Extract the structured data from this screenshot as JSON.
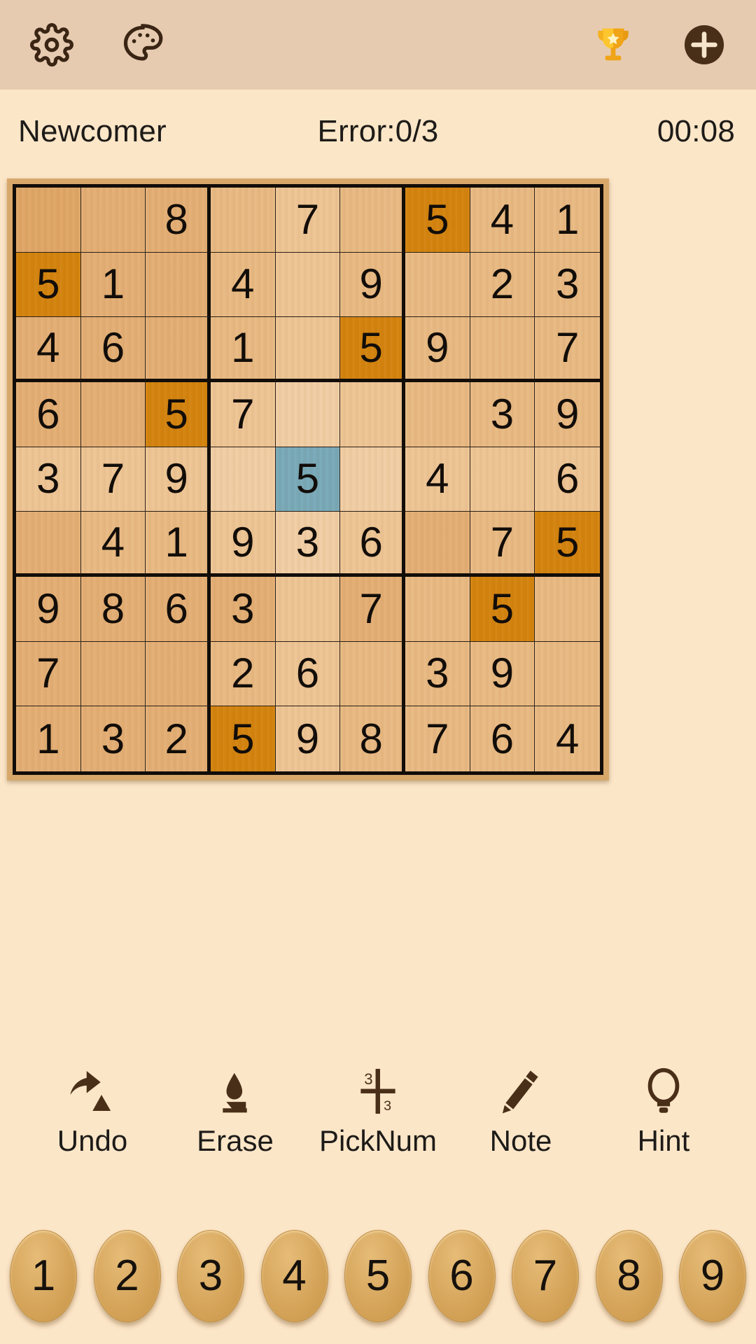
{
  "appbar": {
    "settings_icon": "gear-icon",
    "theme_icon": "palette-icon",
    "trophy_icon": "trophy-icon",
    "add_icon": "plus-circle-icon",
    "background_color": "#e6cbb0"
  },
  "status": {
    "level": "Newcomer",
    "errors": "Error:0/3",
    "timer": "00:08"
  },
  "board": {
    "selected_cell": {
      "row": 5,
      "col": 5,
      "value": "5"
    },
    "highlight_color": "#d3830e",
    "selected_color": "#78a9b8",
    "rows": [
      [
        {
          "v": "",
          "s": "",
          "w": "w0"
        },
        {
          "v": "",
          "s": "",
          "w": "w1"
        },
        {
          "v": "8",
          "s": "",
          "w": "w1"
        },
        {
          "v": "",
          "s": "",
          "w": "w2"
        },
        {
          "v": "7",
          "s": "",
          "w": "w3"
        },
        {
          "v": "",
          "s": "",
          "w": "w2"
        },
        {
          "v": "5",
          "s": "hl",
          "w": "w5"
        },
        {
          "v": "4",
          "s": "",
          "w": "w2"
        },
        {
          "v": "1",
          "s": "",
          "w": "w2"
        }
      ],
      [
        {
          "v": "5",
          "s": "hl",
          "w": "w5"
        },
        {
          "v": "1",
          "s": "",
          "w": "w1"
        },
        {
          "v": "",
          "s": "",
          "w": "w1"
        },
        {
          "v": "4",
          "s": "",
          "w": "w2"
        },
        {
          "v": "",
          "s": "",
          "w": "w3"
        },
        {
          "v": "9",
          "s": "",
          "w": "w2"
        },
        {
          "v": "",
          "s": "",
          "w": "w2"
        },
        {
          "v": "2",
          "s": "",
          "w": "w2"
        },
        {
          "v": "3",
          "s": "",
          "w": "w2"
        }
      ],
      [
        {
          "v": "4",
          "s": "",
          "w": "w1"
        },
        {
          "v": "6",
          "s": "",
          "w": "w1"
        },
        {
          "v": "",
          "s": "",
          "w": "w1"
        },
        {
          "v": "1",
          "s": "",
          "w": "w2"
        },
        {
          "v": "",
          "s": "",
          "w": "w3"
        },
        {
          "v": "5",
          "s": "hl",
          "w": "w5"
        },
        {
          "v": "9",
          "s": "",
          "w": "w2"
        },
        {
          "v": "",
          "s": "",
          "w": "w2"
        },
        {
          "v": "7",
          "s": "",
          "w": "w2"
        }
      ],
      [
        {
          "v": "6",
          "s": "",
          "w": "w1"
        },
        {
          "v": "",
          "s": "",
          "w": "w1"
        },
        {
          "v": "5",
          "s": "hl",
          "w": "w5"
        },
        {
          "v": "7",
          "s": "",
          "w": "w3"
        },
        {
          "v": "",
          "s": "",
          "w": "w4"
        },
        {
          "v": "",
          "s": "",
          "w": "w3"
        },
        {
          "v": "",
          "s": "",
          "w": "w2"
        },
        {
          "v": "3",
          "s": "",
          "w": "w2"
        },
        {
          "v": "9",
          "s": "",
          "w": "w2"
        }
      ],
      [
        {
          "v": "3",
          "s": "",
          "w": "w3"
        },
        {
          "v": "7",
          "s": "",
          "w": "w3"
        },
        {
          "v": "9",
          "s": "",
          "w": "w3"
        },
        {
          "v": "",
          "s": "",
          "w": "w4"
        },
        {
          "v": "5",
          "s": "sel",
          "w": "w4"
        },
        {
          "v": "",
          "s": "",
          "w": "w4"
        },
        {
          "v": "4",
          "s": "",
          "w": "w3"
        },
        {
          "v": "",
          "s": "",
          "w": "w3"
        },
        {
          "v": "6",
          "s": "",
          "w": "w3"
        }
      ],
      [
        {
          "v": "",
          "s": "",
          "w": "w1"
        },
        {
          "v": "4",
          "s": "",
          "w": "w2"
        },
        {
          "v": "1",
          "s": "",
          "w": "w2"
        },
        {
          "v": "9",
          "s": "",
          "w": "w3"
        },
        {
          "v": "3",
          "s": "",
          "w": "w4"
        },
        {
          "v": "6",
          "s": "",
          "w": "w3"
        },
        {
          "v": "",
          "s": "",
          "w": "w1"
        },
        {
          "v": "7",
          "s": "",
          "w": "w2"
        },
        {
          "v": "5",
          "s": "hl",
          "w": "w5"
        }
      ],
      [
        {
          "v": "9",
          "s": "",
          "w": "w1"
        },
        {
          "v": "8",
          "s": "",
          "w": "w1"
        },
        {
          "v": "6",
          "s": "",
          "w": "w1"
        },
        {
          "v": "3",
          "s": "",
          "w": "w1"
        },
        {
          "v": "",
          "s": "",
          "w": "w3"
        },
        {
          "v": "7",
          "s": "",
          "w": "w1"
        },
        {
          "v": "",
          "s": "",
          "w": "w2"
        },
        {
          "v": "5",
          "s": "hl",
          "w": "w5"
        },
        {
          "v": "",
          "s": "",
          "w": "w2"
        }
      ],
      [
        {
          "v": "7",
          "s": "",
          "w": "w1"
        },
        {
          "v": "",
          "s": "",
          "w": "w1"
        },
        {
          "v": "",
          "s": "",
          "w": "w1"
        },
        {
          "v": "2",
          "s": "",
          "w": "w2"
        },
        {
          "v": "6",
          "s": "",
          "w": "w3"
        },
        {
          "v": "",
          "s": "",
          "w": "w2"
        },
        {
          "v": "3",
          "s": "",
          "w": "w2"
        },
        {
          "v": "9",
          "s": "",
          "w": "w2"
        },
        {
          "v": "",
          "s": "",
          "w": "w2"
        }
      ],
      [
        {
          "v": "1",
          "s": "",
          "w": "w1"
        },
        {
          "v": "3",
          "s": "",
          "w": "w1"
        },
        {
          "v": "2",
          "s": "",
          "w": "w1"
        },
        {
          "v": "5",
          "s": "hl",
          "w": "w5"
        },
        {
          "v": "9",
          "s": "",
          "w": "w3"
        },
        {
          "v": "8",
          "s": "",
          "w": "w2"
        },
        {
          "v": "7",
          "s": "",
          "w": "w2"
        },
        {
          "v": "6",
          "s": "",
          "w": "w2"
        },
        {
          "v": "4",
          "s": "",
          "w": "w2"
        }
      ]
    ]
  },
  "toolbar": [
    {
      "label": "Undo",
      "icon": "undo-arrow-icon"
    },
    {
      "label": "Erase",
      "icon": "eraser-icon"
    },
    {
      "label": "PickNum",
      "icon": "pick-number-icon",
      "icon_top_text": "3",
      "icon_bottom_text": "3"
    },
    {
      "label": "Note",
      "icon": "pencil-icon"
    },
    {
      "label": "Hint",
      "icon": "lightbulb-icon"
    }
  ],
  "numpad": [
    "1",
    "2",
    "3",
    "4",
    "5",
    "6",
    "7",
    "8",
    "9"
  ]
}
